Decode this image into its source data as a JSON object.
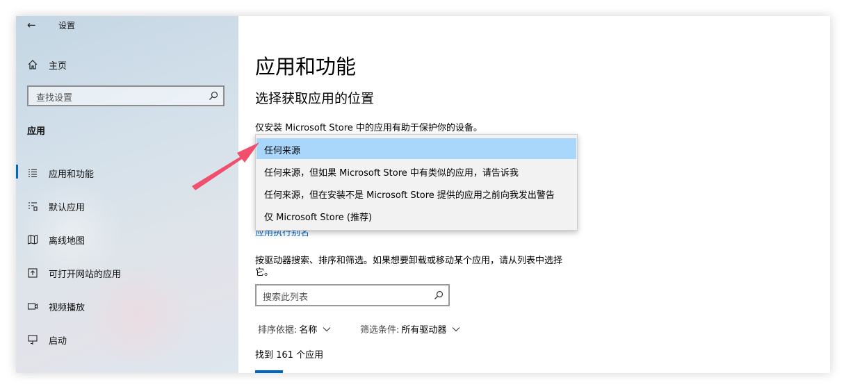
{
  "window": {
    "title": "设置"
  },
  "sidebar": {
    "home_label": "主页",
    "search_placeholder": "查找设置",
    "section_label": "应用",
    "items": [
      {
        "label": "应用和功能",
        "icon": "list-icon"
      },
      {
        "label": "默认应用",
        "icon": "default-apps-icon"
      },
      {
        "label": "离线地图",
        "icon": "map-icon"
      },
      {
        "label": "可打开网站的应用",
        "icon": "web-app-icon"
      },
      {
        "label": "视频播放",
        "icon": "video-icon"
      },
      {
        "label": "启动",
        "icon": "startup-icon"
      }
    ]
  },
  "main": {
    "title": "应用和功能",
    "subtitle": "选择获取应用的位置",
    "description": "仅安装 Microsoft Store 中的应用有助于保护你的设备。",
    "dropdown_options": [
      "任何来源",
      "任何来源，但如果 Microsoft Store 中有类似的应用，请告诉我",
      "任何来源，但在安装不是 Microsoft Store 提供的应用之前向我发出警告",
      "仅 Microsoft Store (推荐)"
    ],
    "alias_link": "应用执行别名",
    "search_description": "按驱动器搜索、排序和筛选。如果想要卸载或移动某个应用，请从列表中选择它。",
    "list_search_placeholder": "搜索此列表",
    "sort_label": "排序依据:",
    "sort_value": "名称",
    "filter_label": "筛选条件:",
    "filter_value": "所有驱动器",
    "apps_found": "找到 161 个应用"
  },
  "colors": {
    "accent": "#0067c0",
    "selection": "#a9d7fc",
    "annotation_arrow": "#f0506e"
  }
}
